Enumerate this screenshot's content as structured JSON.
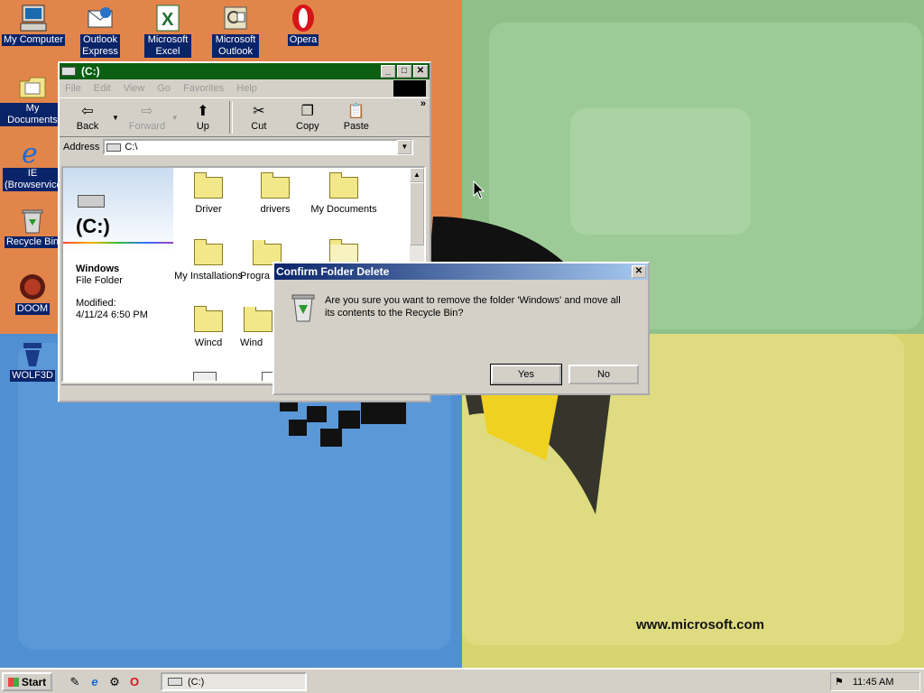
{
  "wallpaper": {
    "url_text": "www.microsoft.com"
  },
  "desktop_icons": [
    {
      "label": "My Computer",
      "icon": "my-computer-icon"
    },
    {
      "label": "Outlook Express",
      "icon": "outlook-express-icon"
    },
    {
      "label": "Microsoft Excel",
      "icon": "excel-icon"
    },
    {
      "label": "Microsoft Outlook",
      "icon": "outlook-icon"
    },
    {
      "label": "Opera",
      "icon": "opera-icon"
    },
    {
      "label": "My Documents",
      "icon": "my-documents-icon"
    },
    {
      "label": "IE (Browservice)",
      "icon": "ie-icon"
    },
    {
      "label": "Recycle Bin",
      "icon": "recycle-bin-icon"
    },
    {
      "label": "DOOM",
      "icon": "doom-icon"
    },
    {
      "label": "WOLF3D",
      "icon": "wolf3d-icon"
    }
  ],
  "explorer": {
    "title": "(C:)",
    "menu": [
      "File",
      "Edit",
      "View",
      "Go",
      "Favorites",
      "Help"
    ],
    "toolbar": {
      "back": "Back",
      "forward": "Forward",
      "up": "Up",
      "cut": "Cut",
      "copy": "Copy",
      "paste": "Paste",
      "more": "»"
    },
    "address_label": "Address",
    "address_value": "C:\\",
    "left_pane": {
      "drive_title": "(C:)",
      "folder_name": "Windows",
      "folder_type": "File Folder",
      "modified_label": "Modified:",
      "modified_value": "4/11/24 6:50 PM"
    },
    "folders": [
      "Driver",
      "drivers",
      "My Documents",
      "My Installations",
      "Progra",
      "Wincd",
      "Wind"
    ]
  },
  "dialog": {
    "title": "Confirm Folder Delete",
    "message": "Are you sure you want to remove the folder 'Windows' and move all its contents to the Recycle Bin?",
    "yes_label": "Yes",
    "no_label": "No"
  },
  "taskbar": {
    "start_label": "Start",
    "quick_launch": [
      "show-desktop-icon",
      "ie-icon",
      "channels-icon",
      "opera-icon"
    ],
    "task_label": "(C:)",
    "clock": "11:45 AM"
  }
}
